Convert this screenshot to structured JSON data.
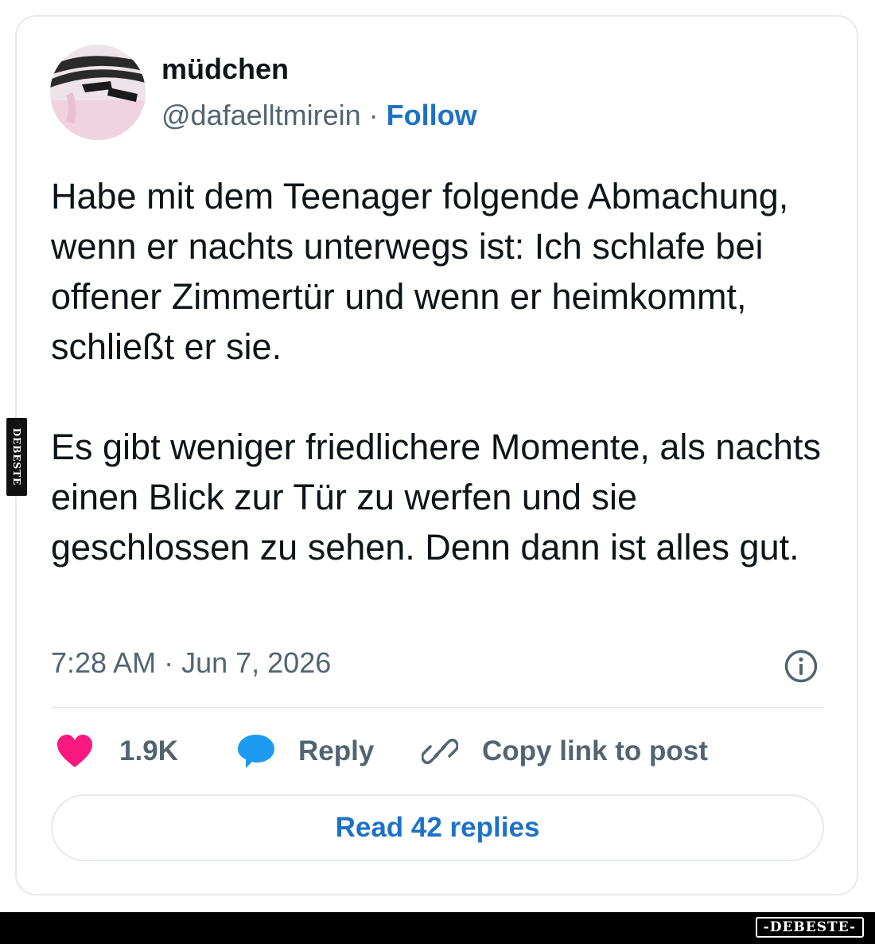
{
  "author": {
    "name": "müdchen",
    "handle": "@dafaelltmirein",
    "separator": "·",
    "follow_label": "Follow"
  },
  "tweet": {
    "paragraphs": [
      "Habe mit dem Teenager folgende Abmachung, wenn er nachts unterwegs ist: Ich schlafe bei offener Zimmertür und wenn er heimkommt, schließt er sie.",
      "Es gibt weniger friedlichere Momente, als nachts einen Blick zur Tür zu werfen und sie geschlossen zu sehen. Denn dann ist alles gut."
    ],
    "timestamp": "7:28 AM · Jun 7, 2026"
  },
  "actions": {
    "like_count": "1.9K",
    "reply_label": "Reply",
    "copy_link_label": "Copy link to post"
  },
  "read_replies_label": "Read 42 replies",
  "watermark": {
    "side": "DEBESTE",
    "footer": "-DEBESTE-"
  },
  "icons": {
    "like": "heart-icon",
    "reply": "speech-bubble-icon",
    "copy": "link-icon",
    "info": "info-icon"
  },
  "colors": {
    "link": "#1d72c7",
    "heart": "#f91880",
    "reply_bubble": "#1d9bf0",
    "muted_text": "#536471",
    "main_text": "#0f1419"
  }
}
